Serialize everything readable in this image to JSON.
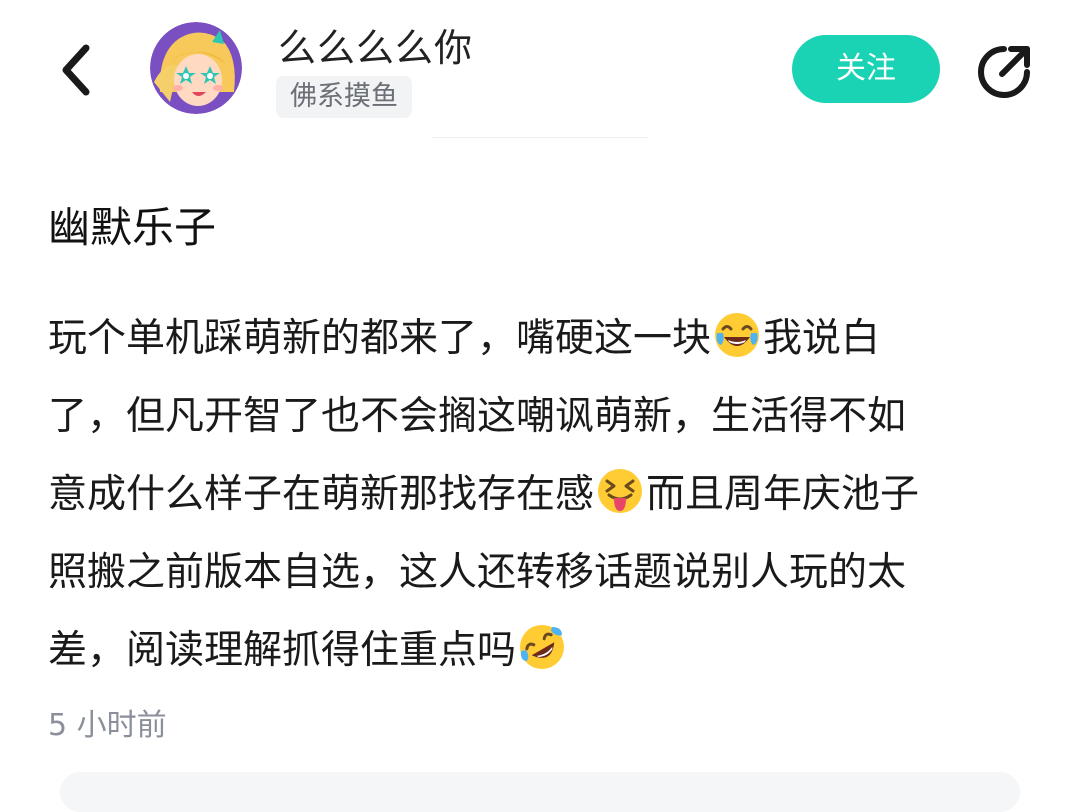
{
  "header": {
    "username": "么么么么你",
    "user_tag": "佛系摸鱼",
    "follow_label": "关注"
  },
  "post": {
    "title": "幽默乐子",
    "lines": [
      {
        "segments": [
          "玩个单机踩萌新的都来了，嘴硬这一块",
          "我说白"
        ],
        "emoji": "tears-of-joy-emoji"
      },
      {
        "segments": [
          "了，但凡开智了也不会搁这嘲讽萌新，生活得不如"
        ]
      },
      {
        "segments": [
          "意成什么样子在萌新那找存在感",
          "而且周年庆池子"
        ],
        "emoji": "squinting-tongue-emoji"
      },
      {
        "segments": [
          "照搬之前版本自选，这人还转移话题说别人玩的太"
        ]
      },
      {
        "segments": [
          "差，阅读理解抓得住重点吗",
          ""
        ],
        "emoji": "rolling-laughing-emoji"
      }
    ],
    "timestamp": "5 小时前"
  },
  "colors": {
    "accent": "#19d3b4",
    "tag_bg": "#f2f3f5",
    "muted_text": "#8a8f99"
  },
  "icons": [
    "back-arrow-icon",
    "avatar",
    "share-icon",
    "tears-of-joy-emoji",
    "squinting-tongue-emoji",
    "rolling-laughing-emoji"
  ]
}
